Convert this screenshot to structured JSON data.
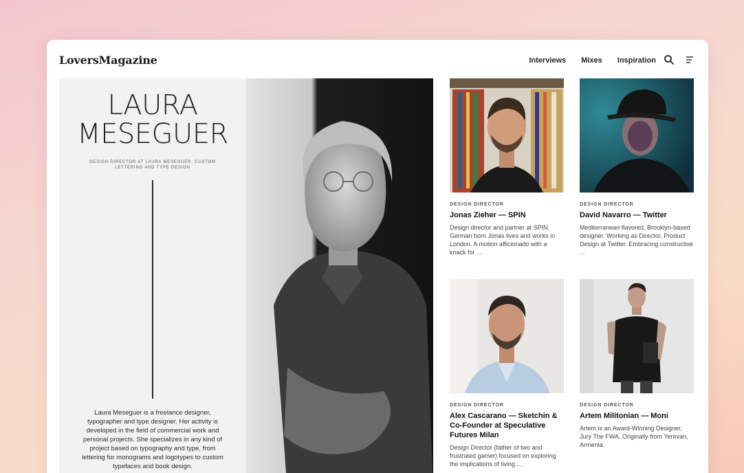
{
  "brand": {
    "logo": "LoversMagazine"
  },
  "nav": {
    "items": [
      "Interviews",
      "Mixes",
      "Inspiration"
    ]
  },
  "icons": {
    "search": "search-icon",
    "menu": "menu-icon"
  },
  "hero": {
    "name": "LAURA MESEGUER",
    "subtitle": "DESIGN DIRECTOR AT LAURA MESEGUER. CUSTOM LETTERING AND TYPE DESIGN",
    "bio": "Laura Meseguer is a freelance designer, typographer and type designer. Her activity is developed in the field of commercial work and personal projects. She specializes in any kind of project based on typography and type, from lettering for monograms and logotypes to custom typefaces and book design."
  },
  "cards": [
    {
      "tag": "DESIGN DIRECTOR",
      "title": "Jonas Zieher — SPIN",
      "desc": "Design director and partner at SPIN. German born Jonas lives and works in London. A motion afficionado with a knack for ..."
    },
    {
      "tag": "DESIGN DIRECTOR",
      "title": "David Navarro — Twitter",
      "desc": "Mediterranean-flavored, Brooklyn-based designer. Working as Director, Product Design at Twitter. Embracing constructive ..."
    },
    {
      "tag": "DESIGN DIRECTOR",
      "title": "Alex Cascarano — Sketchin & Co-Founder at Speculative Futures Milan",
      "desc": "Design Director (father of two and frustrated gamer) focused on exploring the implications of living ..."
    },
    {
      "tag": "DESIGN DIRECTOR",
      "title": "Artem Militonian — Moni",
      "desc": "Artem is an Award-Winning Designer, Jury The FWA. Originally from Yerevan, Armenia."
    }
  ],
  "colors": {
    "background": "#f6d6cf",
    "panel": "#f2f2f2",
    "text": "#222222"
  }
}
